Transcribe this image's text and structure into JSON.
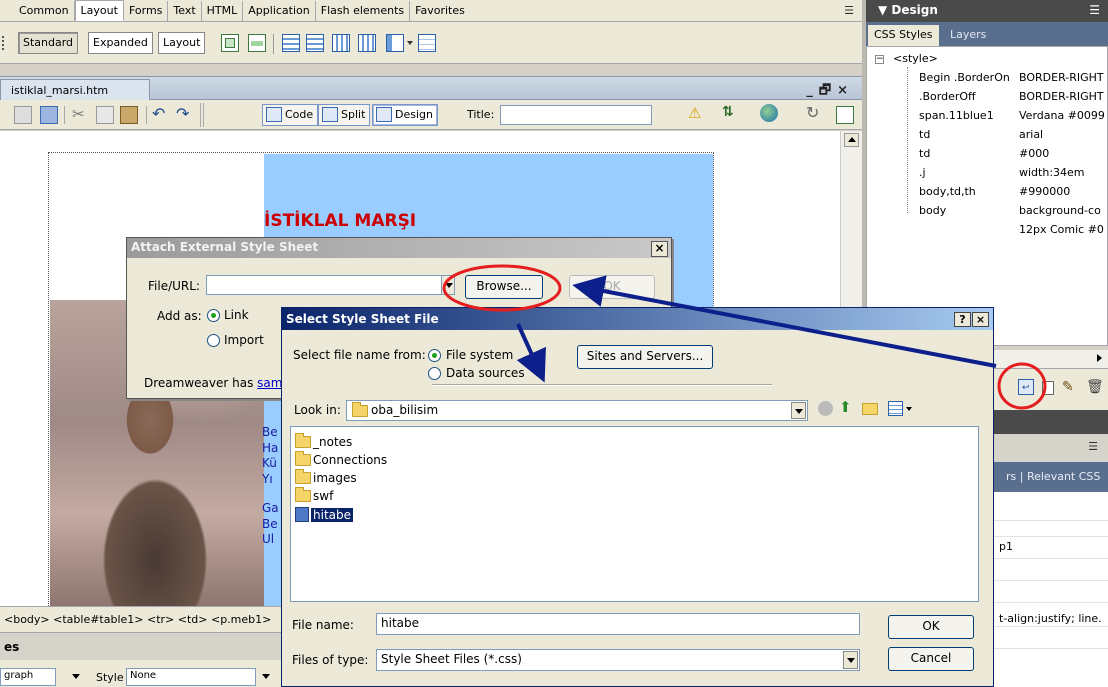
{
  "insert_bar": {
    "tabs": [
      "Common",
      "Layout",
      "Forms",
      "Text",
      "HTML",
      "Application",
      "Flash elements",
      "Favorites"
    ],
    "mode_buttons": [
      "Standard",
      "Expanded",
      "Layout"
    ]
  },
  "document": {
    "filename": "istiklal_marsi.htm",
    "view_buttons": [
      "Code",
      "Split",
      "Design"
    ],
    "title_label": "Title:",
    "title_value": "",
    "heading": "İSTİKLAL MARŞI",
    "poem_fragments": [
      "Be",
      "Ha",
      "Kü",
      "Yı",
      "",
      "Ga",
      "Be",
      "Ul"
    ]
  },
  "tag_selector": "<body> <table#table1> <tr> <td> <p.meb1>",
  "properties": {
    "header": "es",
    "format_value": "graph",
    "style_label": "Style",
    "style_value": "None"
  },
  "right_panel": {
    "design_header": "▼ Design",
    "tabs": [
      "CSS Styles",
      "Layers"
    ],
    "root": "<style>",
    "rules": [
      {
        "selector": "Begin .BorderOn",
        "value": "BORDER-RIGHT"
      },
      {
        "selector": ".BorderOff",
        "value": "BORDER-RIGHT"
      },
      {
        "selector": "span.11blue1",
        "value": "Verdana #0099"
      },
      {
        "selector": "td",
        "value": "arial"
      },
      {
        "selector": "td",
        "value": "#000"
      },
      {
        "selector": ".j",
        "value": "width:34em"
      },
      {
        "selector": "body,td,th",
        "value": "#990000"
      },
      {
        "selector": "body",
        "value": "background-co"
      },
      {
        "selector": "",
        "value": "12px Comic #0"
      }
    ],
    "relevant_tabs": "rs  |  Relevant CSS",
    "relevant_text1": "p1",
    "relevant_text2": "t-align:justify; line."
  },
  "attach_dialog": {
    "title": "Attach External Style Sheet",
    "file_url_label": "File/URL:",
    "file_url_value": "",
    "browse_label": "Browse...",
    "ok_label": "OK",
    "add_as_label": "Add as:",
    "option_link": "Link",
    "option_import": "Import",
    "note_prefix": "Dreamweaver has ",
    "note_link": "samp"
  },
  "select_dialog": {
    "title": "Select Style Sheet File",
    "select_from_label": "Select file name from:",
    "option_file_system": "File system",
    "option_data_sources": "Data sources",
    "sites_button": "Sites and Servers...",
    "look_in_label": "Look in:",
    "look_in_value": "oba_bilisim",
    "files": [
      {
        "name": "_notes",
        "kind": "folder"
      },
      {
        "name": "Connections",
        "kind": "folder"
      },
      {
        "name": "images",
        "kind": "folder"
      },
      {
        "name": "swf",
        "kind": "folder"
      },
      {
        "name": "hitabe",
        "kind": "file",
        "selected": true
      }
    ],
    "file_name_label": "File name:",
    "file_name_value": "hitabe",
    "files_of_type_label": "Files of type:",
    "files_of_type_value": "Style Sheet Files (*.css)",
    "ok_label": "OK",
    "cancel_label": "Cancel"
  },
  "colors": {
    "annotation_red": "#e41e1e",
    "annotation_arrow": "#0c1f8a",
    "heading_red": "#cc0000",
    "page_blue": "#99ccff"
  }
}
